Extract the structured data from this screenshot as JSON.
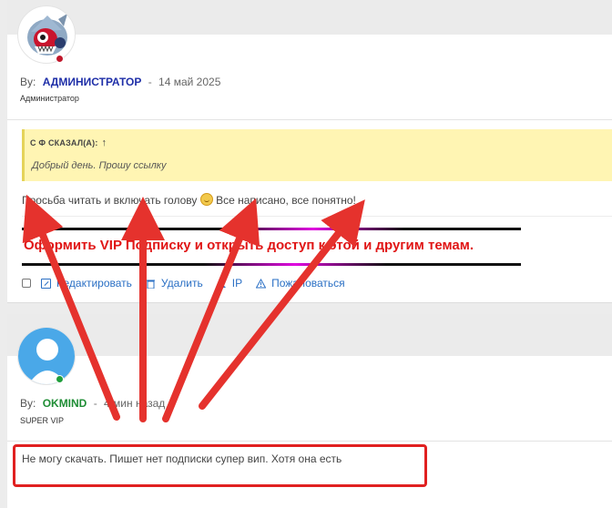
{
  "post1": {
    "by_label": "By:",
    "author": "АДМИНИСТРАТОР",
    "separator": "-",
    "date": "14 май 2025",
    "role": "Администратор",
    "quote": {
      "header": "С Ф СКАЗАЛ(А):",
      "header_icon": "↑",
      "text": "Добрый день. Прошу ссылку"
    },
    "message_part1": "Просьба читать и включать голову",
    "message_part2": "Все написано, все понятно!",
    "vip_banner": "Оформить VIP Подписку и открыть доступ к этой и другим темам.",
    "actions": {
      "edit": "Редактировать",
      "delete": "Удалить",
      "ip": "IP",
      "report": "Пожаловаться"
    }
  },
  "post2": {
    "by_label": "By:",
    "author": "OKMIND",
    "separator": "-",
    "date": "4 мин назад",
    "role": "SUPER VIP",
    "message": "Не могу скачать. Пишет нет подписки супер вип. Хотя она есть"
  },
  "colors": {
    "admin_name": "#1f2fa8",
    "okmind_name": "#1f8d35",
    "link": "#2a6fc4",
    "vip_text": "#e01515",
    "arrow": "#e5322d",
    "quote_bg": "#fff5b3"
  },
  "icons": {
    "quote_arrow": "arrow-up-icon",
    "edit": "edit-icon",
    "delete": "delete-icon",
    "ip": "ip-person-icon",
    "report": "warning-icon",
    "smiley": "smiley-icon",
    "avatar1": "shark-avatar",
    "avatar2": "default-user-avatar"
  }
}
